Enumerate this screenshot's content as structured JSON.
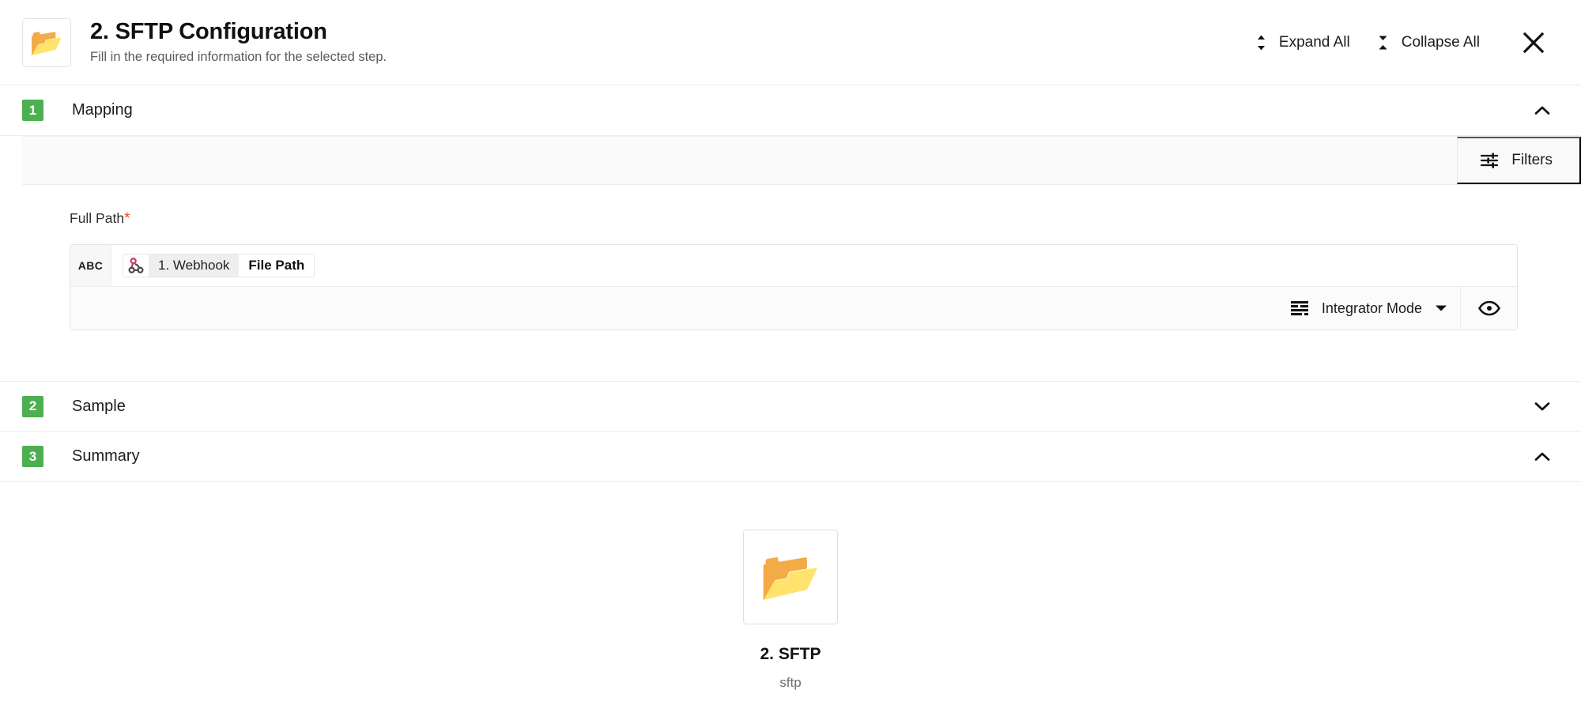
{
  "header": {
    "icon": "open-folder-emoji",
    "title": "2. SFTP Configuration",
    "subtitle": "Fill in the required information for the selected step.",
    "expand_all_label": "Expand All",
    "collapse_all_label": "Collapse All",
    "expand_icon": "unfold-more-icon",
    "collapse_icon": "unfold-less-icon",
    "close_icon": "close-icon"
  },
  "sections": [
    {
      "number": "1",
      "title": "Mapping",
      "expanded": true,
      "chevron": "chevron-up-icon"
    },
    {
      "number": "2",
      "title": "Sample",
      "expanded": false,
      "chevron": "chevron-down-icon"
    },
    {
      "number": "3",
      "title": "Summary",
      "expanded": true,
      "chevron": "chevron-up-icon"
    }
  ],
  "mapping": {
    "toolbar": {
      "filters_label": "Filters",
      "filters_icon": "tune-sliders-icon"
    },
    "field": {
      "label": "Full Path",
      "required_marker": "*",
      "type_badge": "ABC",
      "value": "",
      "placeholder": "",
      "token": {
        "icon": "webhook-icon",
        "source": "1. Webhook",
        "field": "File Path"
      },
      "mode_label": "Integrator Mode",
      "mode_icon": "view-headline-icon",
      "mode_caret": "caret-down-icon",
      "preview_icon": "eye-icon"
    }
  },
  "summary": {
    "card_icon": "open-folder-emoji",
    "name": "2. SFTP",
    "type": "sftp"
  },
  "colors": {
    "step_badge_green": "#4caf50",
    "required_red": "#f44336",
    "webhook_pink": "#c9356e",
    "webhook_gray": "#4a4a4a",
    "toolbar_gray": "#fafafa"
  }
}
